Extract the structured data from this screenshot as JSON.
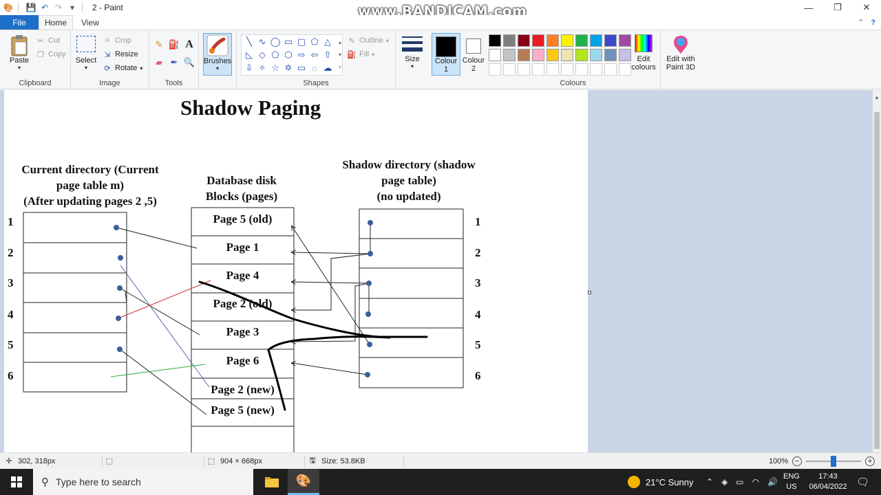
{
  "window": {
    "title": "2 - Paint",
    "watermark": "www.BANDICAM.com"
  },
  "tabs": {
    "file": "File",
    "home": "Home",
    "view": "View"
  },
  "ribbon": {
    "clipboard": {
      "label": "Clipboard",
      "paste": "Paste",
      "cut": "Cut",
      "copy": "Copy"
    },
    "image": {
      "label": "Image",
      "select": "Select",
      "crop": "Crop",
      "resize": "Resize",
      "rotate": "Rotate"
    },
    "tools": {
      "label": "Tools"
    },
    "brushes": {
      "label": "Brushes"
    },
    "shapes": {
      "label": "Shapes",
      "outline": "Outline",
      "fill": "Fill"
    },
    "size": {
      "label": "Size"
    },
    "colour1": {
      "label1": "Colour",
      "label2": "1",
      "value": "#000000"
    },
    "colour2": {
      "label1": "Colour",
      "label2": "2",
      "value": "#ffffff"
    },
    "colours": {
      "label": "Colours",
      "edit1": "Edit",
      "edit2": "colours"
    },
    "paint3d": {
      "label1": "Edit with",
      "label2": "Paint 3D"
    },
    "palette_row1": [
      "#000000",
      "#7f7f7f",
      "#880015",
      "#ed1c24",
      "#ff7f27",
      "#fff200",
      "#22b14c",
      "#00a2e8",
      "#3f48cc",
      "#a349a4"
    ],
    "palette_row2": [
      "#ffffff",
      "#c3c3c3",
      "#b97a57",
      "#ffaec9",
      "#ffc90e",
      "#efe4b0",
      "#b5e61d",
      "#99d9ea",
      "#7092be",
      "#c8bfe7"
    ]
  },
  "diagram": {
    "title": "Shadow Paging",
    "current_dir": {
      "line1": "Current directory (Current",
      "line2": "page table m)",
      "line3": "(After updating pages 2 ,5)"
    },
    "disk": {
      "line1": "Database disk",
      "line2": "Blocks (pages)"
    },
    "shadow_dir": {
      "line1": "Shadow directory (shadow",
      "line2": "page table)",
      "line3": "(no updated)"
    },
    "row_numbers": [
      "1",
      "2",
      "3",
      "4",
      "5",
      "6"
    ],
    "pages": [
      "Page 5 (old)",
      "Page 1",
      "Page 4",
      "Page 2 (old)",
      "Page 3",
      "Page 6",
      "Page 2 (new)",
      "Page 5 (new)"
    ]
  },
  "status": {
    "cursor_pos": "302, 318px",
    "dimensions": "904 × 668px",
    "size": "Size: 53.8KB",
    "zoom": "100%"
  },
  "taskbar": {
    "search_placeholder": "Type here to search",
    "weather": "21°C  Sunny",
    "lang1": "ENG",
    "lang2": "US",
    "time": "17:43",
    "date": "06/04/2022"
  }
}
